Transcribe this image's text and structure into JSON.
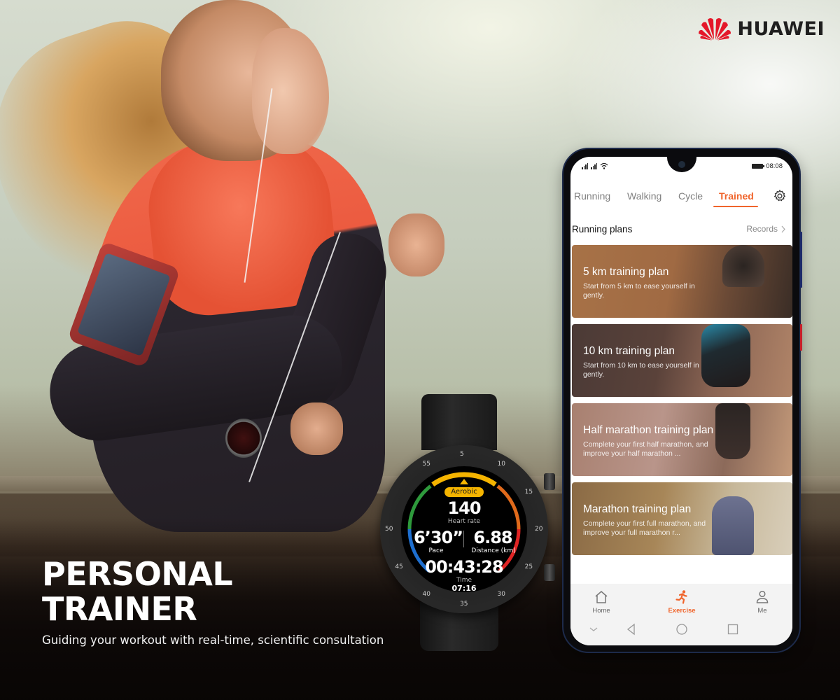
{
  "brand": {
    "name": "HUAWEI",
    "logo_icon": "huawei-petal-logo",
    "color": "#e4182a"
  },
  "hero": {
    "title_line1": "PERSONAL",
    "title_line2": "TRAINER",
    "subtitle": "Guiding your workout with real-time, scientific consultation"
  },
  "watch": {
    "zone_badge": "Aerobic",
    "heart_rate_value": "140",
    "heart_rate_label": "Heart rate",
    "pace_value": "6’30”",
    "pace_label": "Pace",
    "distance_value": "6.88",
    "distance_label": "Distance (km)",
    "time_value": "00:43:28",
    "time_label": "Time",
    "clock": "07:16",
    "bezel_numbers": [
      "55",
      "5",
      "10",
      "15",
      "20",
      "25",
      "30",
      "35",
      "40",
      "45",
      "50"
    ],
    "zone_colors": {
      "blue": "#1e6fd0",
      "green": "#2e9a3c",
      "yellow": "#f5b400",
      "orange": "#e06a1b",
      "red": "#e02424"
    }
  },
  "phone": {
    "status_bar": {
      "signal_left": "⁴ᴳ",
      "time": "08:08"
    },
    "tabs": [
      {
        "label": "Running",
        "active": false
      },
      {
        "label": "Walking",
        "active": false
      },
      {
        "label": "Cycle",
        "active": false
      },
      {
        "label": "Trained",
        "active": true
      }
    ],
    "accent_color": "#f0642b",
    "settings_icon": "gear-icon",
    "section": {
      "title": "Running plans",
      "link_label": "Records"
    },
    "plans": [
      {
        "title": "5 km training plan",
        "description": "Start from 5 km to ease yourself in gently."
      },
      {
        "title": "10 km training plan",
        "description": "Start from 10 km to ease yourself in gently."
      },
      {
        "title": "Half marathon training plan",
        "description": "Complete your first half marathon, and improve your half marathon ..."
      },
      {
        "title": "Marathon training plan",
        "description": "Complete your first full marathon, and improve your full marathon r..."
      }
    ],
    "bottom_nav": [
      {
        "label": "Home",
        "icon": "home-icon",
        "active": false
      },
      {
        "label": "Exercise",
        "icon": "running-icon",
        "active": true
      },
      {
        "label": "Me",
        "icon": "person-icon",
        "active": false
      }
    ],
    "system_nav": [
      "collapse-icon",
      "back-icon",
      "home-circle-icon",
      "recents-icon"
    ]
  }
}
